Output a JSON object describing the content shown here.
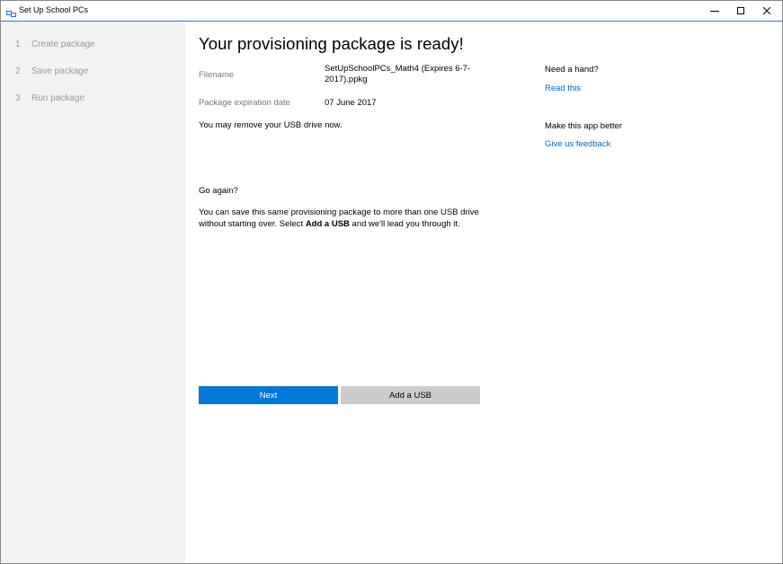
{
  "window": {
    "title": "Set Up School PCs"
  },
  "sidebar": {
    "steps": [
      {
        "number": "1",
        "label": "Create package"
      },
      {
        "number": "2",
        "label": "Save package"
      },
      {
        "number": "3",
        "label": "Run package"
      }
    ]
  },
  "main": {
    "heading": "Your provisioning package is ready!",
    "filename_label": "Filename",
    "filename_value_line1": "SetUpSchoolPCs_Math4 (Expires 6-7-",
    "filename_value_line2": "2017).ppkg",
    "expiration_label": "Package expiration date",
    "expiration_value": "07 June 2017",
    "usb_message": "You may remove your USB drive now.",
    "go_again": "Go again?",
    "desc_part1": "You can save this same provisioning package to more than one USB drive without starting over. Select ",
    "desc_bold": "Add a USB",
    "desc_part2": " and we'll lead you through it."
  },
  "help": {
    "need_hand": "Need a hand?",
    "read_this": "Read this",
    "make_better": "Make this app better",
    "feedback": "Give us feedback"
  },
  "buttons": {
    "next": "Next",
    "add_usb": "Add a USB"
  },
  "colors": {
    "accent": "#0078d7",
    "link": "#0067c0",
    "sidebar_bg": "#f2f2f2",
    "secondary_button": "#cccccc"
  }
}
